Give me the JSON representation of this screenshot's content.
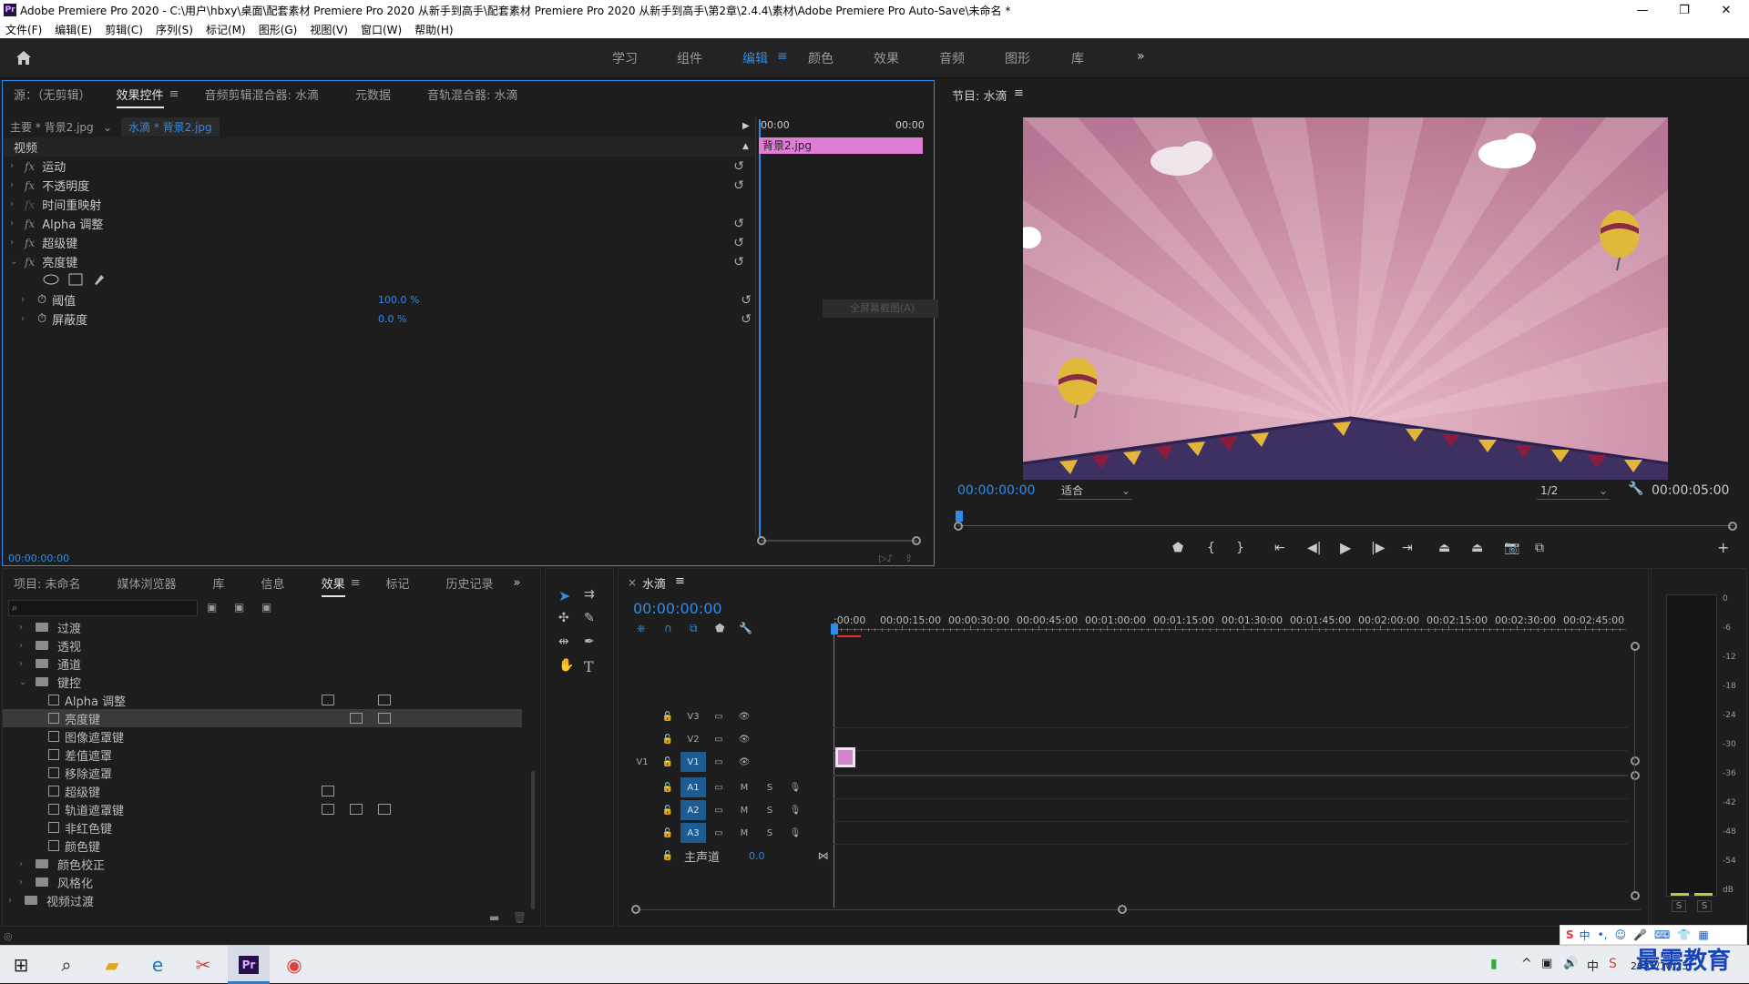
{
  "window": {
    "title": "Adobe Premiere Pro 2020 - C:\\用户\\hbxy\\桌面\\配套素材 Premiere Pro 2020 从新手到高手\\配套素材 Premiere Pro 2020 从新手到高手\\第2章\\2.4.4\\素材\\Adobe Premiere Pro Auto-Save\\未命名 *",
    "logo": "Pr",
    "minimize": "—",
    "restore": "❐",
    "close": "✕"
  },
  "menu": [
    "文件(F)",
    "编辑(E)",
    "剪辑(C)",
    "序列(S)",
    "标记(M)",
    "图形(G)",
    "视图(V)",
    "窗口(W)",
    "帮助(H)"
  ],
  "workspaces": {
    "home_icon": "home-icon",
    "items": [
      "学习",
      "组件",
      "编辑",
      "颜色",
      "效果",
      "音频",
      "图形",
      "库"
    ],
    "active": "编辑",
    "menu_glyph": "≡",
    "more": "»"
  },
  "effect_controls": {
    "tabs": [
      "源：（无剪辑）",
      "效果控件",
      "音频剪辑混合器: 水滴",
      "元数据",
      "音轨混合器: 水滴"
    ],
    "tab_menu": "≡",
    "master": "主要 * 背景2.jpg",
    "clip": "水滴 * 背景2.jpg",
    "section": "视频",
    "effects": [
      "运动",
      "不透明度",
      "时间重映射",
      "Alpha 调整",
      "超级键",
      "亮度键"
    ],
    "fx_symbol": "fx",
    "params": [
      {
        "name": "阈值",
        "value": "100.0 %"
      },
      {
        "name": "屏蔽度",
        "value": "0.0 %"
      }
    ],
    "ruler": [
      "00:00",
      "00:00"
    ],
    "clip_bar": "背景2.jpg",
    "tooltip": "全屏幕截图(A)",
    "timecode": "00:00:00:00"
  },
  "program_monitor": {
    "title": "节目: 水滴",
    "title_menu": "≡",
    "timecode": "00:00:00:00",
    "fit": "适合",
    "resolution": "1/2",
    "duration": "00:00:05:00",
    "colors": {
      "sky_light": "#c98aa2",
      "sky_dark": "#a2647e",
      "ground": "#3e3162",
      "accent": "#2d8ceb"
    }
  },
  "project_panel": {
    "tabs": [
      "项目: 未命名",
      "媒体浏览器",
      "库",
      "信息",
      "效果",
      "标记",
      "历史记录"
    ],
    "active_tab": "效果",
    "tab_menu": "≡",
    "more": "»",
    "search_icon": "search-icon",
    "tree": [
      {
        "label": "过渡",
        "type": "folder",
        "indent": 1
      },
      {
        "label": "透视",
        "type": "folder",
        "indent": 1
      },
      {
        "label": "通道",
        "type": "folder",
        "indent": 1
      },
      {
        "label": "键控",
        "type": "folder-open",
        "indent": 1
      },
      {
        "label": "Alpha 调整",
        "type": "effect",
        "indent": 2
      },
      {
        "label": "亮度键",
        "type": "effect",
        "indent": 2,
        "selected": true
      },
      {
        "label": "图像遮罩键",
        "type": "effect",
        "indent": 2
      },
      {
        "label": "差值遮罩",
        "type": "effect",
        "indent": 2
      },
      {
        "label": "移除遮罩",
        "type": "effect",
        "indent": 2
      },
      {
        "label": "超级键",
        "type": "effect",
        "indent": 2
      },
      {
        "label": "轨道遮罩键",
        "type": "effect",
        "indent": 2
      },
      {
        "label": "非红色键",
        "type": "effect",
        "indent": 2
      },
      {
        "label": "颜色键",
        "type": "effect",
        "indent": 2
      },
      {
        "label": "颜色校正",
        "type": "folder",
        "indent": 1
      },
      {
        "label": "风格化",
        "type": "folder",
        "indent": 1
      },
      {
        "label": "视频过渡",
        "type": "folder",
        "indent": 0
      }
    ]
  },
  "timeline": {
    "title": "水滴",
    "close": "×",
    "menu": "≡",
    "timecode": "00:00:00:00",
    "ruler": [
      ":00:00",
      "00:00:15:00",
      "00:00:30:00",
      "00:00:45:00",
      "00:01:00:00",
      "00:01:15:00",
      "00:01:30:00",
      "00:01:45:00",
      "00:02:00:00",
      "00:02:15:00",
      "00:02:30:00",
      "00:02:45:00"
    ],
    "video_tracks": [
      "V3",
      "V2",
      "V1"
    ],
    "source_patch": "V1",
    "audio_tracks": [
      "A1",
      "A2",
      "A3"
    ],
    "mute": "M",
    "solo": "S",
    "master": "主声道",
    "master_value": "0.0"
  },
  "meters": {
    "scale": [
      "0",
      "-6",
      "-12",
      "-18",
      "-24",
      "-30",
      "-36",
      "-42",
      "-48",
      "-54",
      "dB"
    ],
    "solo": [
      "S",
      "S"
    ]
  },
  "taskbar": {
    "time": "",
    "date": "2021/10/25",
    "ime": "中",
    "watermark": "最需教育"
  }
}
